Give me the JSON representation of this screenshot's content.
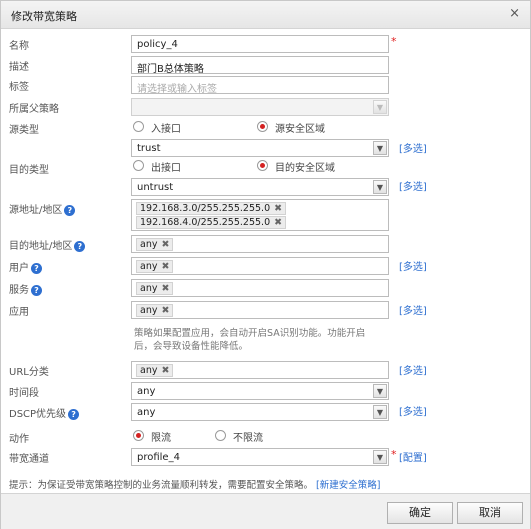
{
  "dialog": {
    "title": "修改带宽策略",
    "close": "×"
  },
  "form": {
    "name": {
      "label": "名称",
      "value": "policy_4",
      "required": "*"
    },
    "desc": {
      "label": "描述",
      "value": "部门B总体策略"
    },
    "tags": {
      "label": "标签",
      "placeholder": "请选择或输入标签"
    },
    "parent": {
      "label": "所属父策略",
      "value": ""
    },
    "src_type": {
      "label": "源类型",
      "options": [
        "入接口",
        "源安全区域"
      ],
      "selected": "源安全区域",
      "value": "trust",
      "more": "[多选]"
    },
    "dst_type": {
      "label": "目的类型",
      "options": [
        "出接口",
        "目的安全区域"
      ],
      "selected": "目的安全区域",
      "value": "untrust",
      "more": "[多选]"
    },
    "src_addr": {
      "label": "源地址/地区",
      "tags": [
        "192.168.3.0/255.255.255.0",
        "192.168.4.0/255.255.255.0"
      ]
    },
    "dst_addr": {
      "label": "目的地址/地区",
      "tags": [
        "any"
      ]
    },
    "user": {
      "label": "用户",
      "tags": [
        "any"
      ],
      "more": "[多选]"
    },
    "service": {
      "label": "服务",
      "tags": [
        "any"
      ]
    },
    "app": {
      "label": "应用",
      "tags": [
        "any"
      ],
      "more": "[多选]",
      "hint": "策略如果配置应用，会自动开启SA识别功能。功能开启后，会导致设备性能降低。"
    },
    "url": {
      "label": "URL分类",
      "tags": [
        "any"
      ],
      "more": "[多选]"
    },
    "time": {
      "label": "时间段",
      "value": "any"
    },
    "dscp": {
      "label": "DSCP优先级",
      "value": "any",
      "more": "[多选]"
    },
    "action": {
      "label": "动作",
      "options": [
        "限流",
        "不限流"
      ],
      "selected": "限流"
    },
    "channel": {
      "label": "带宽通道",
      "value": "profile_4",
      "required": "*",
      "config": "[配置]"
    }
  },
  "footer": {
    "tip_prefix": "提示：为保证受带宽策略控制的业务流量顺利转发，需要配置安全策略。",
    "tip_link": "[新建安全策略]",
    "ok": "确定",
    "cancel": "取消"
  },
  "icons": {
    "help": "question-mark-circle-icon",
    "dropdown": "chevron-down-icon",
    "remove": "x-icon"
  },
  "colors": {
    "link": "#2e6fd0",
    "required": "#e02020",
    "radio_selected": "#d42222",
    "help_icon": "#2e6fd0"
  }
}
